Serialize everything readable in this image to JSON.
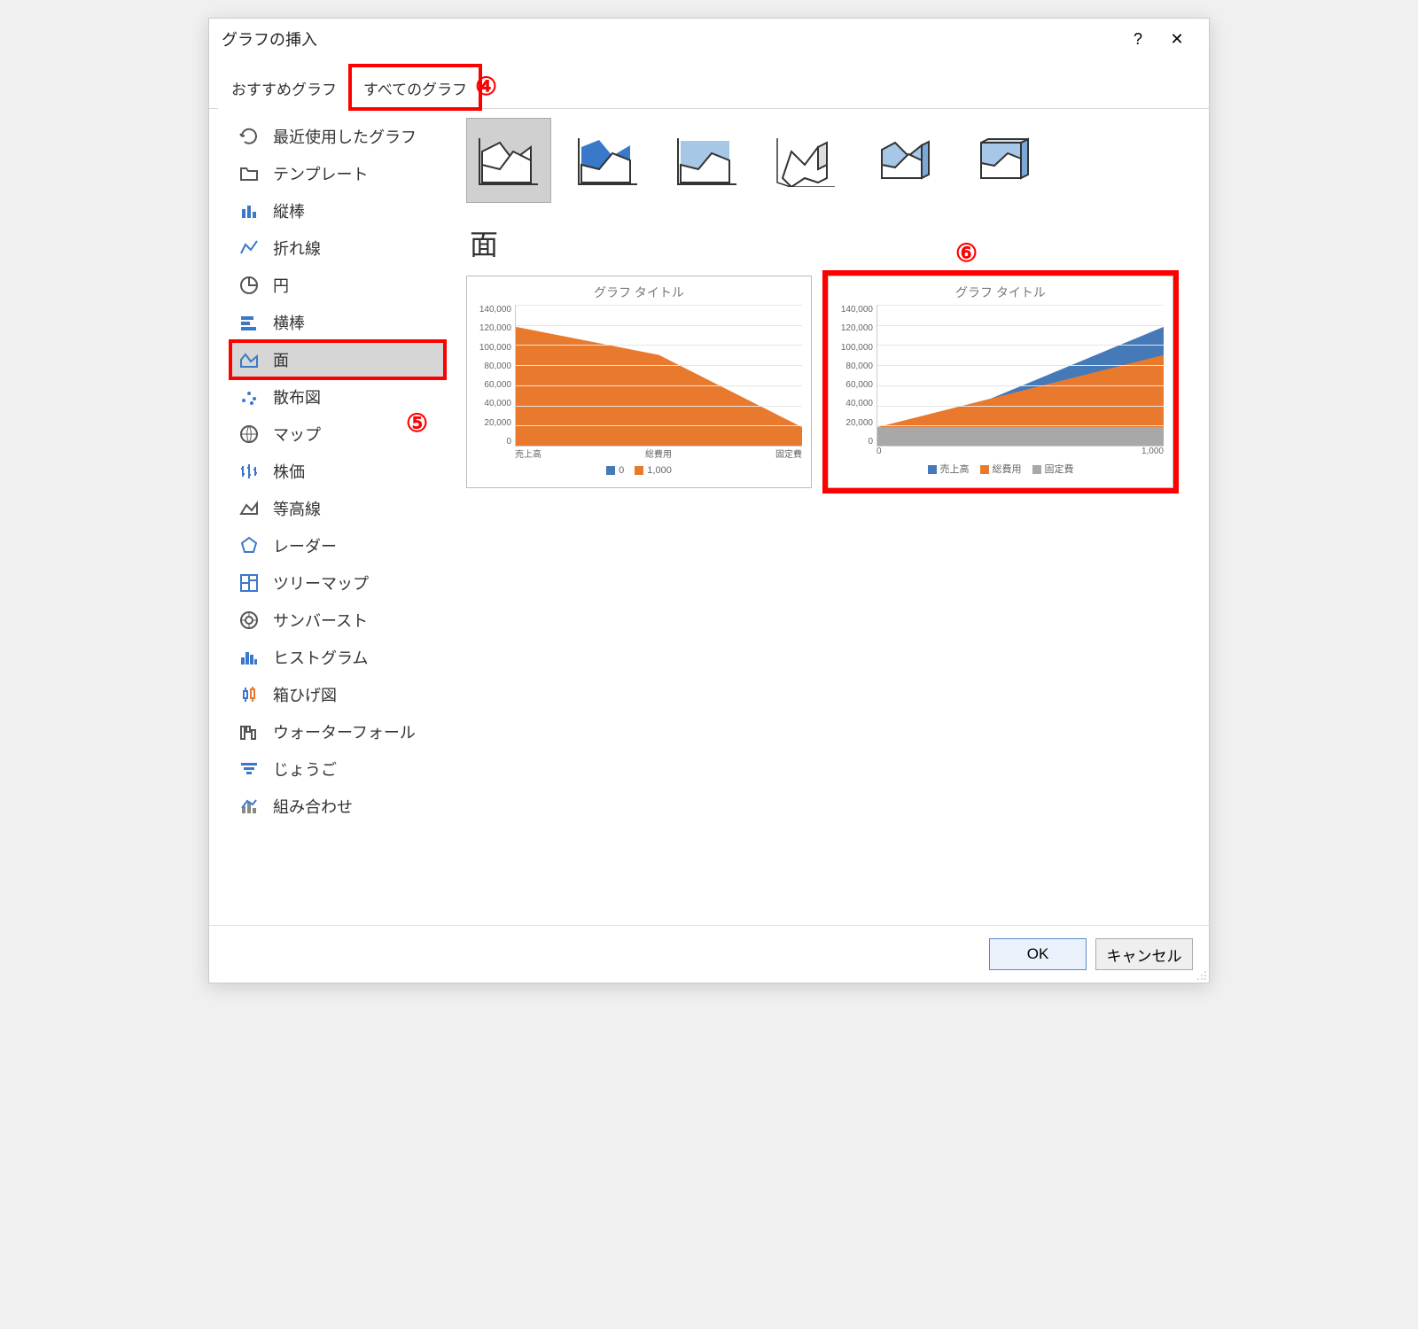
{
  "dialog_title": "グラフの挿入",
  "help_symbol": "?",
  "close_symbol": "✕",
  "tabs": [
    {
      "label": "おすすめグラフ",
      "selected": false
    },
    {
      "label": "すべてのグラフ",
      "selected": true
    }
  ],
  "annotations": {
    "a4": "④",
    "a5": "⑤",
    "a6": "⑥"
  },
  "sidebar": {
    "items": [
      {
        "label": "最近使用したグラフ"
      },
      {
        "label": "テンプレート"
      },
      {
        "label": "縦棒"
      },
      {
        "label": "折れ線"
      },
      {
        "label": "円"
      },
      {
        "label": "横棒"
      },
      {
        "label": "面",
        "selected": true
      },
      {
        "label": "散布図"
      },
      {
        "label": "マップ"
      },
      {
        "label": "株価"
      },
      {
        "label": "等高線"
      },
      {
        "label": "レーダー"
      },
      {
        "label": "ツリーマップ"
      },
      {
        "label": "サンバースト"
      },
      {
        "label": "ヒストグラム"
      },
      {
        "label": "箱ひげ図"
      },
      {
        "label": "ウォーターフォール"
      },
      {
        "label": "じょうご"
      },
      {
        "label": "組み合わせ"
      }
    ]
  },
  "section_title": "面",
  "subtypes": [
    {
      "name": "area-2d",
      "selected": true
    },
    {
      "name": "area-stacked"
    },
    {
      "name": "area-100stacked"
    },
    {
      "name": "area-3d"
    },
    {
      "name": "area-3d-stacked"
    },
    {
      "name": "area-3d-100stacked"
    }
  ],
  "previews": {
    "a": {
      "title": "グラフ タイトル",
      "yticks": [
        "140,000",
        "120,000",
        "100,000",
        "80,000",
        "60,000",
        "40,000",
        "20,000",
        "0"
      ],
      "xticks": [
        "売上高",
        "総費用",
        "固定費"
      ],
      "legend": [
        {
          "label": "0",
          "color": "#4579b8"
        },
        {
          "label": "1,000",
          "color": "#e8792d"
        }
      ]
    },
    "b": {
      "title": "グラフ タイトル",
      "yticks": [
        "140,000",
        "120,000",
        "100,000",
        "80,000",
        "60,000",
        "40,000",
        "20,000",
        "0"
      ],
      "xticks": [
        "0",
        "1,000"
      ],
      "legend": [
        {
          "label": "売上高",
          "color": "#4579b8"
        },
        {
          "label": "総費用",
          "color": "#e8792d"
        },
        {
          "label": "固定費",
          "color": "#a8a8a8"
        }
      ]
    }
  },
  "buttons": {
    "ok": "OK",
    "cancel": "キャンセル"
  },
  "colors": {
    "blue": "#4579b8",
    "orange": "#e8792d",
    "gray": "#a8a8a8",
    "lightblue": "#a7c7e7",
    "highlight": "#f00"
  },
  "chart_data": [
    {
      "type": "area",
      "title": "グラフ タイトル",
      "categories": [
        "売上高",
        "総費用",
        "固定費"
      ],
      "series": [
        {
          "name": "0",
          "values": [
            0,
            0,
            0
          ]
        },
        {
          "name": "1,000",
          "values": [
            118000,
            90000,
            18000
          ]
        }
      ],
      "ylim": [
        0,
        140000
      ],
      "xlabel": "",
      "ylabel": ""
    },
    {
      "type": "area",
      "title": "グラフ タイトル",
      "x": [
        0,
        1000
      ],
      "series": [
        {
          "name": "売上高",
          "values": [
            0,
            118000
          ]
        },
        {
          "name": "総費用",
          "values": [
            18000,
            90000
          ]
        },
        {
          "name": "固定費",
          "values": [
            18000,
            18000
          ]
        }
      ],
      "ylim": [
        0,
        140000
      ],
      "xlabel": "",
      "ylabel": ""
    }
  ]
}
